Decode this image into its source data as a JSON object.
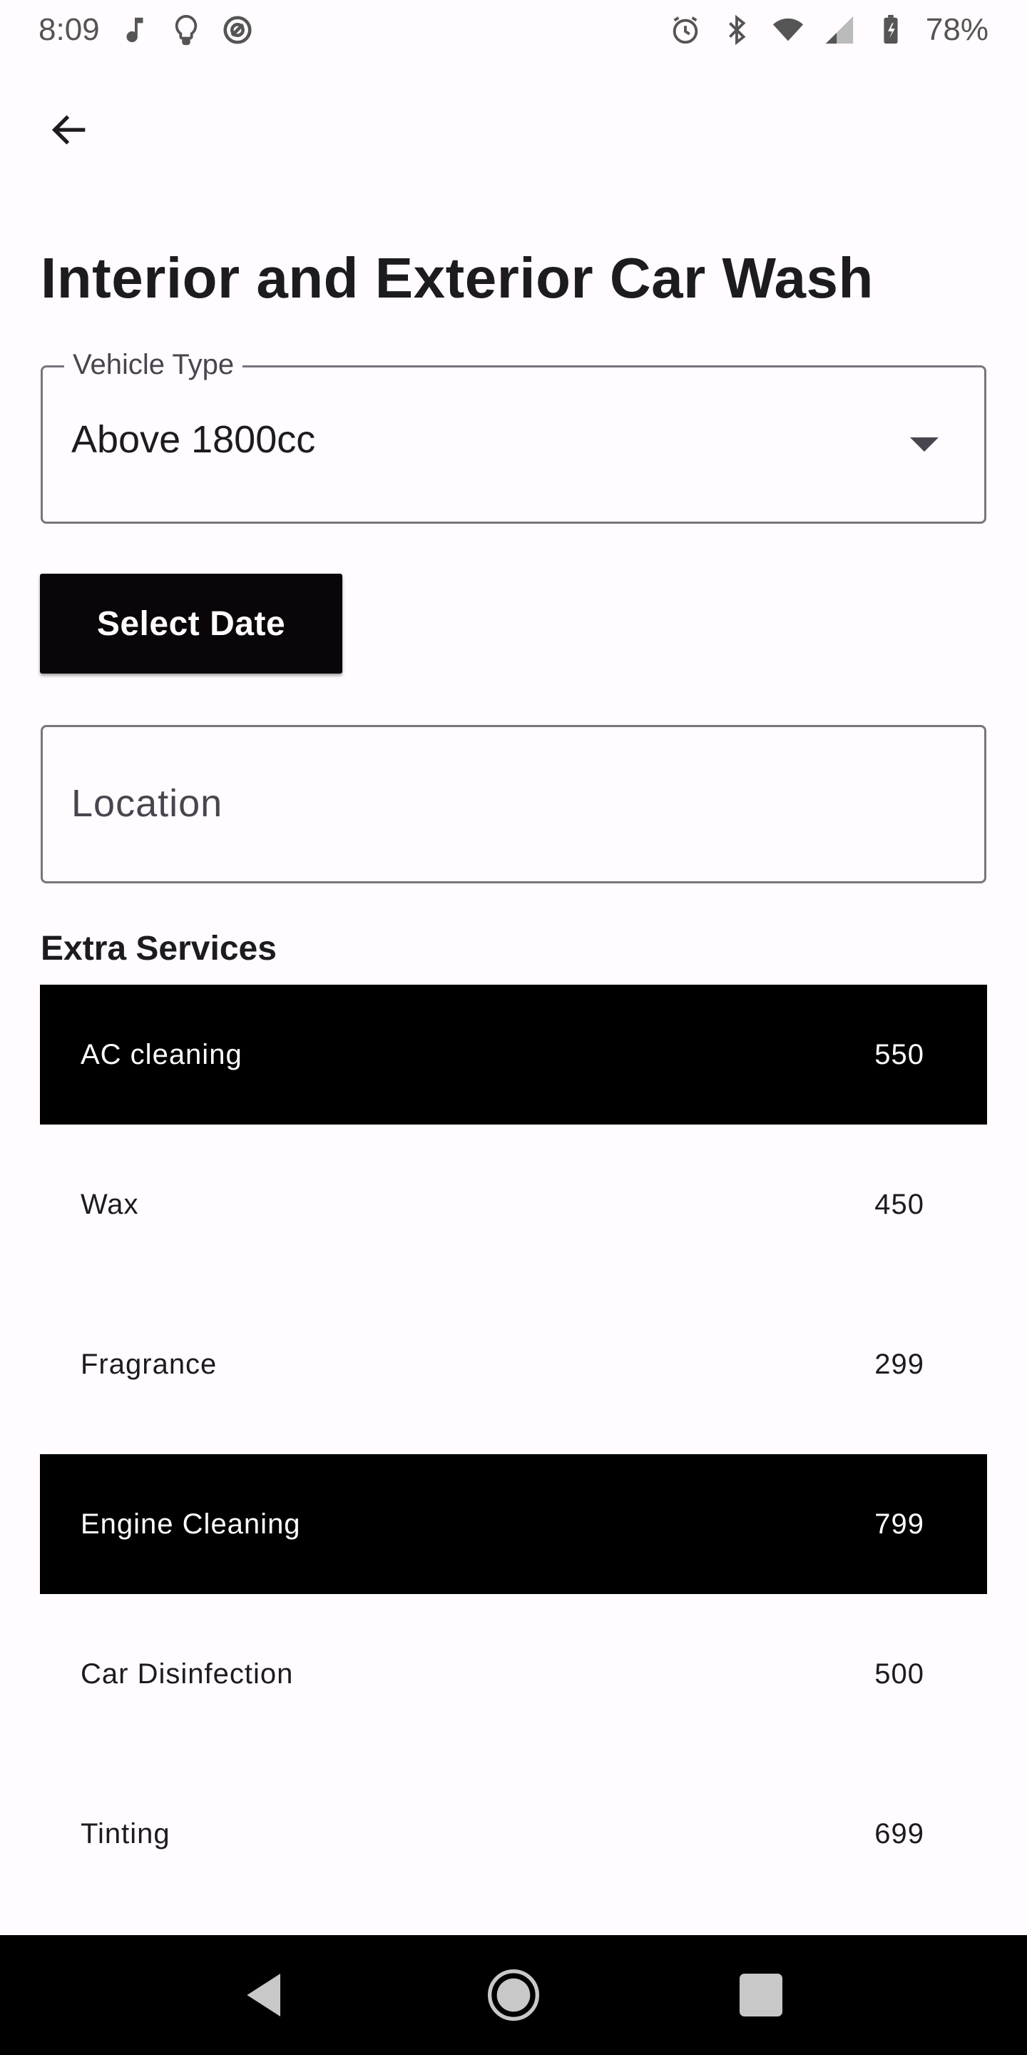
{
  "status_bar": {
    "time": "8:09",
    "battery": "78%",
    "icons_left": [
      "music-note-icon",
      "lightbulb-icon",
      "at-sign-icon"
    ],
    "icons_right": [
      "alarm-icon",
      "bluetooth-icon",
      "wifi-icon",
      "signal-icon",
      "battery-icon"
    ]
  },
  "page": {
    "title": "Interior and Exterior Car Wash"
  },
  "vehicle_type": {
    "label": "Vehicle Type",
    "value": "Above 1800cc"
  },
  "select_date": {
    "label": "Select Date"
  },
  "location": {
    "placeholder": "Location"
  },
  "extra_services": {
    "title": "Extra Services",
    "items": [
      {
        "name": "AC cleaning",
        "price": "550",
        "selected": true
      },
      {
        "name": "Wax",
        "price": "450",
        "selected": false
      },
      {
        "name": "Fragrance",
        "price": "299",
        "selected": false
      },
      {
        "name": "Engine Cleaning",
        "price": "799",
        "selected": true
      },
      {
        "name": "Car Disinfection",
        "price": "500",
        "selected": false
      },
      {
        "name": "Tinting",
        "price": "699",
        "selected": false
      }
    ]
  },
  "colors": {
    "background": "#fffbfe",
    "selected_row": "#000000",
    "button": "#0a0509",
    "outline": "#79747e"
  }
}
